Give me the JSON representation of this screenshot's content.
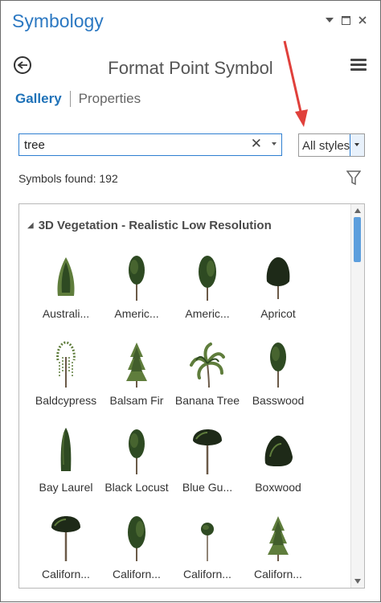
{
  "window": {
    "title": "Symbology",
    "pin_icon": "chevron-down-icon",
    "restore_icon": "restore-icon",
    "close_icon": "close-icon"
  },
  "header": {
    "title": "Format Point Symbol",
    "back_icon": "back-arrow-icon",
    "menu_icon": "hamburger-menu-icon"
  },
  "tabs": [
    {
      "label": "Gallery",
      "active": true
    },
    {
      "label": "Properties",
      "active": false
    }
  ],
  "search": {
    "value": "tree",
    "placeholder": ""
  },
  "style_filter": {
    "selected": "All styles"
  },
  "results": {
    "text": "Symbols found: 192"
  },
  "gallery": {
    "group_title": "3D Vegetation - Realistic Low Resolution",
    "symbols": [
      {
        "label": "Australi...",
        "tree": "cypress"
      },
      {
        "label": "Americ...",
        "tree": "round"
      },
      {
        "label": "Americ...",
        "tree": "tall"
      },
      {
        "label": "Apricot",
        "tree": "bushy"
      },
      {
        "label": "Baldcypress",
        "tree": "sparse"
      },
      {
        "label": "Balsam Fir",
        "tree": "fir"
      },
      {
        "label": "Banana Tree",
        "tree": "palm"
      },
      {
        "label": "Basswood",
        "tree": "round"
      },
      {
        "label": "Bay Laurel",
        "tree": "column"
      },
      {
        "label": "Black Locust",
        "tree": "round"
      },
      {
        "label": "Blue Gu...",
        "tree": "spread"
      },
      {
        "label": "Boxwood",
        "tree": "shrub"
      },
      {
        "label": "Californ...",
        "tree": "spread"
      },
      {
        "label": "Californ...",
        "tree": "tall"
      },
      {
        "label": "Californ...",
        "tree": "small"
      },
      {
        "label": "Californ...",
        "tree": "fir"
      }
    ]
  },
  "colors": {
    "accent": "#2b78c2",
    "foliage": "#2e4a22",
    "foliage_light": "#5f7d3c",
    "trunk": "#6b5a48"
  }
}
